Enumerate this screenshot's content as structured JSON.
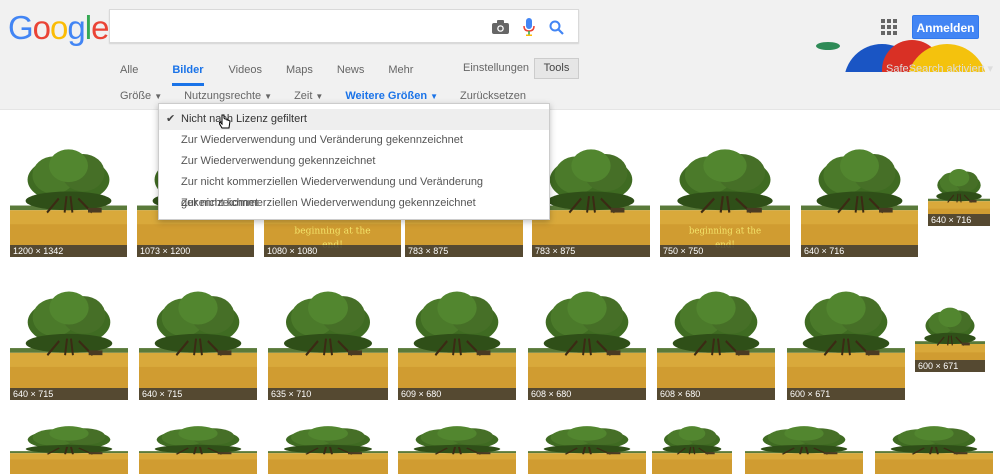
{
  "header": {
    "logo_letters": [
      "G",
      "o",
      "o",
      "g",
      "l",
      "e"
    ],
    "logo_colors": [
      "#4285f4",
      "#ea4335",
      "#fbbc05",
      "#4285f4",
      "#34a853",
      "#ea4335"
    ],
    "search": {
      "value": "",
      "placeholder": ""
    },
    "signin": "Anmelden",
    "safesearch": "SafeSearch aktiviert ▾"
  },
  "tabs": [
    {
      "label": "Alle"
    },
    {
      "label": "Bilder"
    },
    {
      "label": "Videos"
    },
    {
      "label": "Maps"
    },
    {
      "label": "News"
    },
    {
      "label": "Mehr"
    }
  ],
  "toolbar": {
    "settings": "Einstellungen",
    "tools": "Tools"
  },
  "filters": [
    {
      "label": "Größe",
      "caret": "▼"
    },
    {
      "label": "Nutzungsrechte",
      "caret": "▼"
    },
    {
      "label": "Zeit",
      "caret": "▼"
    },
    {
      "label": "Weitere Größen",
      "caret": "▼"
    },
    {
      "label": "Zurücksetzen",
      "caret": ""
    }
  ],
  "menu": {
    "items": [
      "Nicht nach Lizenz gefiltert",
      "Zur Wiederverwendung und Veränderung gekennzeichnet",
      "Zur Wiederverwendung gekennzeichnet",
      "Zur nicht kommerziellen Wiederverwendung und Veränderung gekennzeichnet",
      "Zur nicht kommerziellen Wiederverwendung gekennzeichnet"
    ]
  },
  "thumbs": {
    "row1": [
      "1200 × 1342",
      "1073 × 1200",
      "1080 × 1080",
      "783 × 875",
      "783 × 875",
      "750 × 750",
      "640 × 716",
      "640 × 716"
    ],
    "row2": [
      "640 × 715",
      "640 × 715",
      "635 × 710",
      "609 × 680",
      "608 × 680",
      "608 × 680",
      "600 × 671",
      "600 × 671"
    ],
    "overlay_text": "beginning at the end!"
  },
  "colors": {
    "accent": "#1a73e8",
    "signin": "#4285f4",
    "field": "#d9a93b",
    "tree": "#3f6b22"
  }
}
